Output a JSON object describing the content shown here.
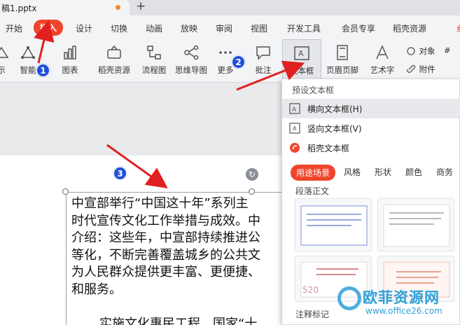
{
  "window": {
    "doc_tab": "稿1.pptx",
    "new_tab": "+"
  },
  "menu": {
    "items": [
      "开始",
      "插入",
      "设计",
      "切换",
      "动画",
      "放映",
      "审阅",
      "视图",
      "开发工具",
      "会员专享",
      "稻壳资源"
    ],
    "active": "插入",
    "edge": "纟"
  },
  "ribbon": {
    "partial_left": "示",
    "smart": "智能",
    "chart": "图表",
    "daoke": "稻壳资源",
    "flow": "流程图",
    "mindmap": "思维导图",
    "more": "更多",
    "comment": "批注",
    "textbox": "文本框",
    "header_footer": "页眉页脚",
    "art_text": "艺术字",
    "object": "对象",
    "attachment": "附件",
    "partial_right": "#"
  },
  "dropdown": {
    "header": "预设文本框",
    "horizontal": "横向文本框(H)",
    "vertical": "竖向文本框(V)",
    "daoke_textbox": "稻壳文本框",
    "tabs": [
      "用途场景",
      "风格",
      "形状",
      "颜色",
      "商务"
    ],
    "active_tab": "用途场景",
    "subtitle": "段落正文",
    "footer": "注释标记"
  },
  "slide": {
    "paragraph": "中宣部举行“中国这十年”系列主\n时代宣传文化工作举措与成效。中\n介绍：这些年，中宣部持续推进公\n等化，不断完善覆盖城乡的公共文\n为人民群众提供更丰富、更便捷、\n和服务。",
    "paragraph2": "实施文化惠民工程，国家“十"
  },
  "annotations": {
    "b1": "1",
    "b2": "2",
    "b3": "3"
  },
  "watermark": {
    "title": "欧菲资源网",
    "url": "www.office26.com"
  },
  "colors": {
    "accent": "#f0452c",
    "badge": "#1f4fd6",
    "arrow": "#e02020"
  }
}
